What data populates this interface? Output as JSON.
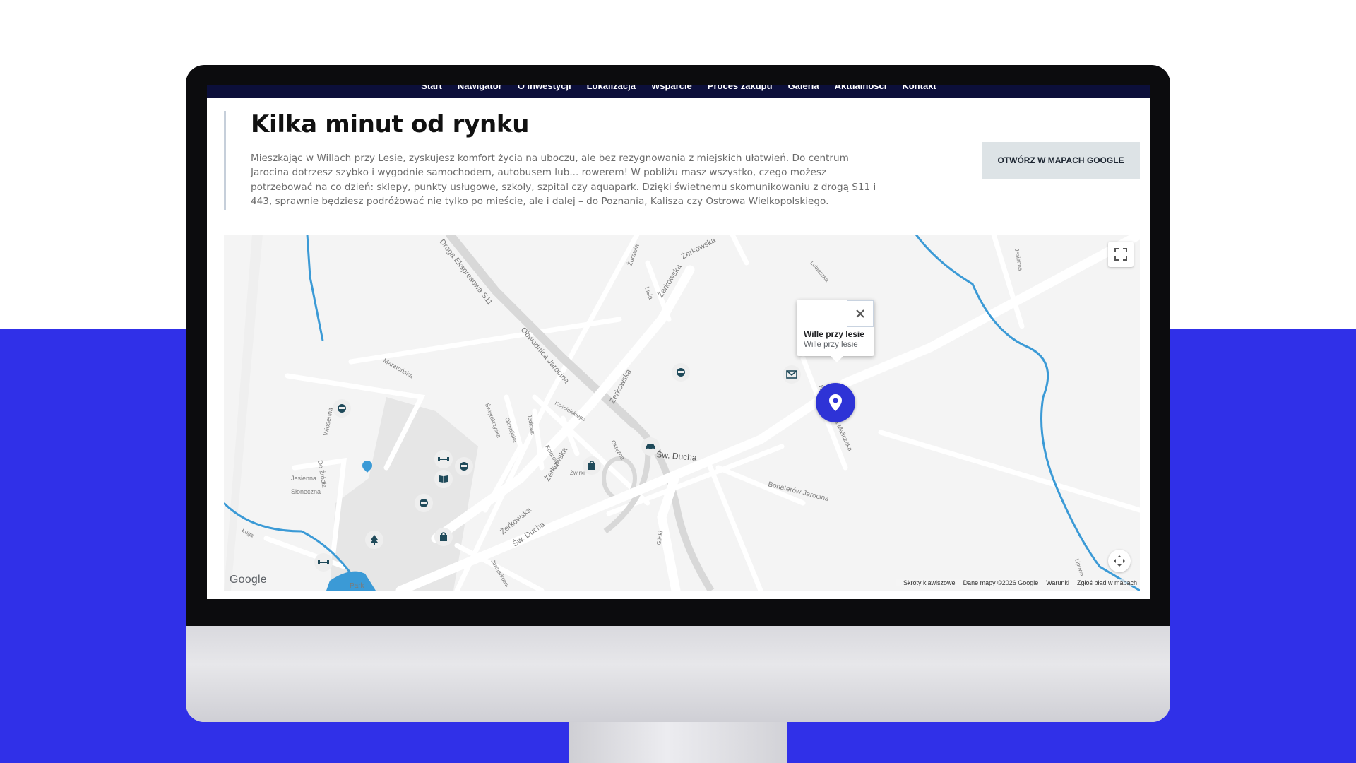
{
  "nav": {
    "items": [
      "Start",
      "Nawigator",
      "O inwestycji",
      "Lokalizacja",
      "Wsparcie",
      "Proces zakupu",
      "Galeria",
      "Aktualności",
      "Kontakt"
    ]
  },
  "section": {
    "title": "Kilka minut od rynku",
    "description": "Mieszkając w Willach przy Lesie, zyskujesz komfort życia na uboczu, ale bez rezygnowania z miejskich ułatwień. Do centrum Jarocina dotrzesz szybko i wygodnie samochodem, autobusem lub... rowerem! W pobliżu masz wszystko, czego możesz potrzebować na co dzień: sklepy, punkty usługowe, szkoły, szpital czy aquapark. Dzięki świetnemu skomunikowaniu z drogą S11 i 443, sprawnie będziesz podróżować nie tylko po mieście, ale i dalej – do Poznania, Kalisza czy Ostrowa Wielkopolskiego.",
    "maps_button": "OTWÓRZ W MAPACH GOOGLE"
  },
  "map": {
    "street_labels": [
      "Droga Ekspresowa S11",
      "Obwodnica Jarocina",
      "Żerkowska",
      "Żerkowska",
      "Żerkowska",
      "Żerkowska",
      "Żerkowska",
      "Żurawia",
      "Lisia",
      "Św. Ducha",
      "Św. Ducha",
      "Bohaterów Jarocina",
      "Ks. Franciszka Maliczaka",
      "Maratońska",
      "Wiosenna",
      "Do Źródła",
      "Jesienna",
      "Słoneczna",
      "Świętokrzyska",
      "Olimpijska",
      "Jodłowa",
      "Kolorowa",
      "Kościelskiego",
      "Okrężna",
      "Żwirki",
      "Glinki",
      "Jarmarkowa",
      "Jesienna",
      "Lubieszka",
      "Lipowa",
      "Park",
      "Ługa"
    ],
    "poi_icons": [
      "bus-stop-icon",
      "bus-stop-icon",
      "bus-stop-icon",
      "bus-stop-icon",
      "mail-icon",
      "car-icon",
      "shopping-bag-icon",
      "shopping-bag-icon",
      "gym-icon",
      "gym-icon",
      "library-icon",
      "tree-icon",
      "water-drop-icon"
    ],
    "info_window": {
      "title": "Wille przy lesie",
      "subtitle": "Wille przy lesie"
    },
    "google_logo": "Google",
    "attribution": [
      "Skróty klawiszowe",
      "Dane mapy ©2026 Google",
      "Warunki",
      "Zgłoś błąd w mapach"
    ],
    "colors": {
      "marker": "#2e33d6",
      "water": "#3b9ad6",
      "poi_icon": "#1f4a5a",
      "background_band": "#3030e8"
    }
  }
}
